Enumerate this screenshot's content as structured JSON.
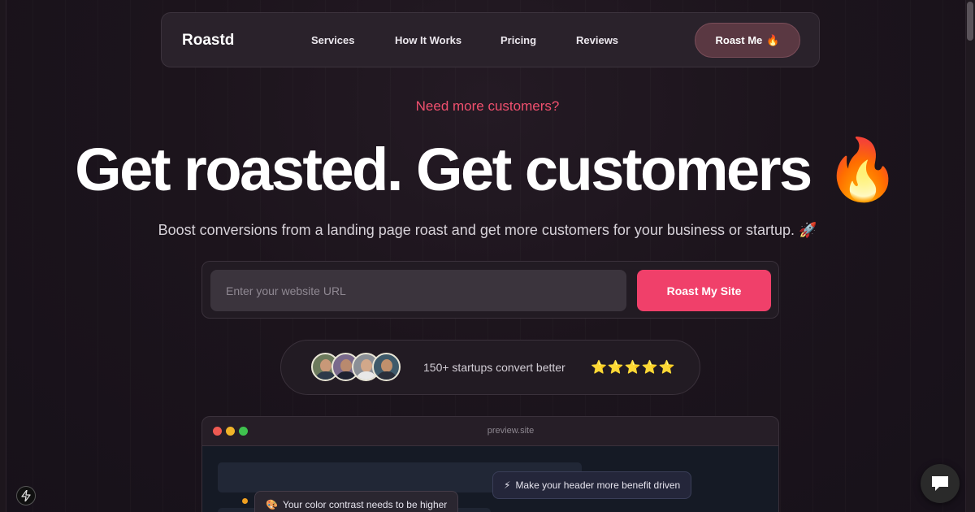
{
  "nav": {
    "logo": "Roastd",
    "links": [
      "Services",
      "How It Works",
      "Pricing",
      "Reviews"
    ],
    "cta_label": "Roast Me",
    "cta_emoji": "🔥"
  },
  "hero": {
    "eyebrow": "Need more customers?",
    "headline": "Get roasted. Get customers",
    "headline_emoji": "🔥",
    "subhead": "Boost conversions from a landing page roast and get more customers for your business or startup. 🚀"
  },
  "form": {
    "url_placeholder": "Enter your website URL",
    "url_value": "",
    "submit_label": "Roast My Site"
  },
  "social_proof": {
    "text": "150+ startups convert better",
    "rating": 5,
    "stars": "⭐⭐⭐⭐⭐",
    "avatar_count": 4
  },
  "preview": {
    "url": "preview.site",
    "tips": [
      {
        "icon": "⚡",
        "text": "Make your header more benefit driven"
      },
      {
        "icon": "🎨",
        "text": "Your color contrast needs to be higher"
      }
    ]
  },
  "colors": {
    "accent": "#f0406a",
    "eyebrow": "#f0506e",
    "background": "#1c141c",
    "nav_cta": "#5a3842"
  },
  "icons": {
    "chat": "chat-bubble-icon",
    "bolt": "bolt-icon"
  }
}
